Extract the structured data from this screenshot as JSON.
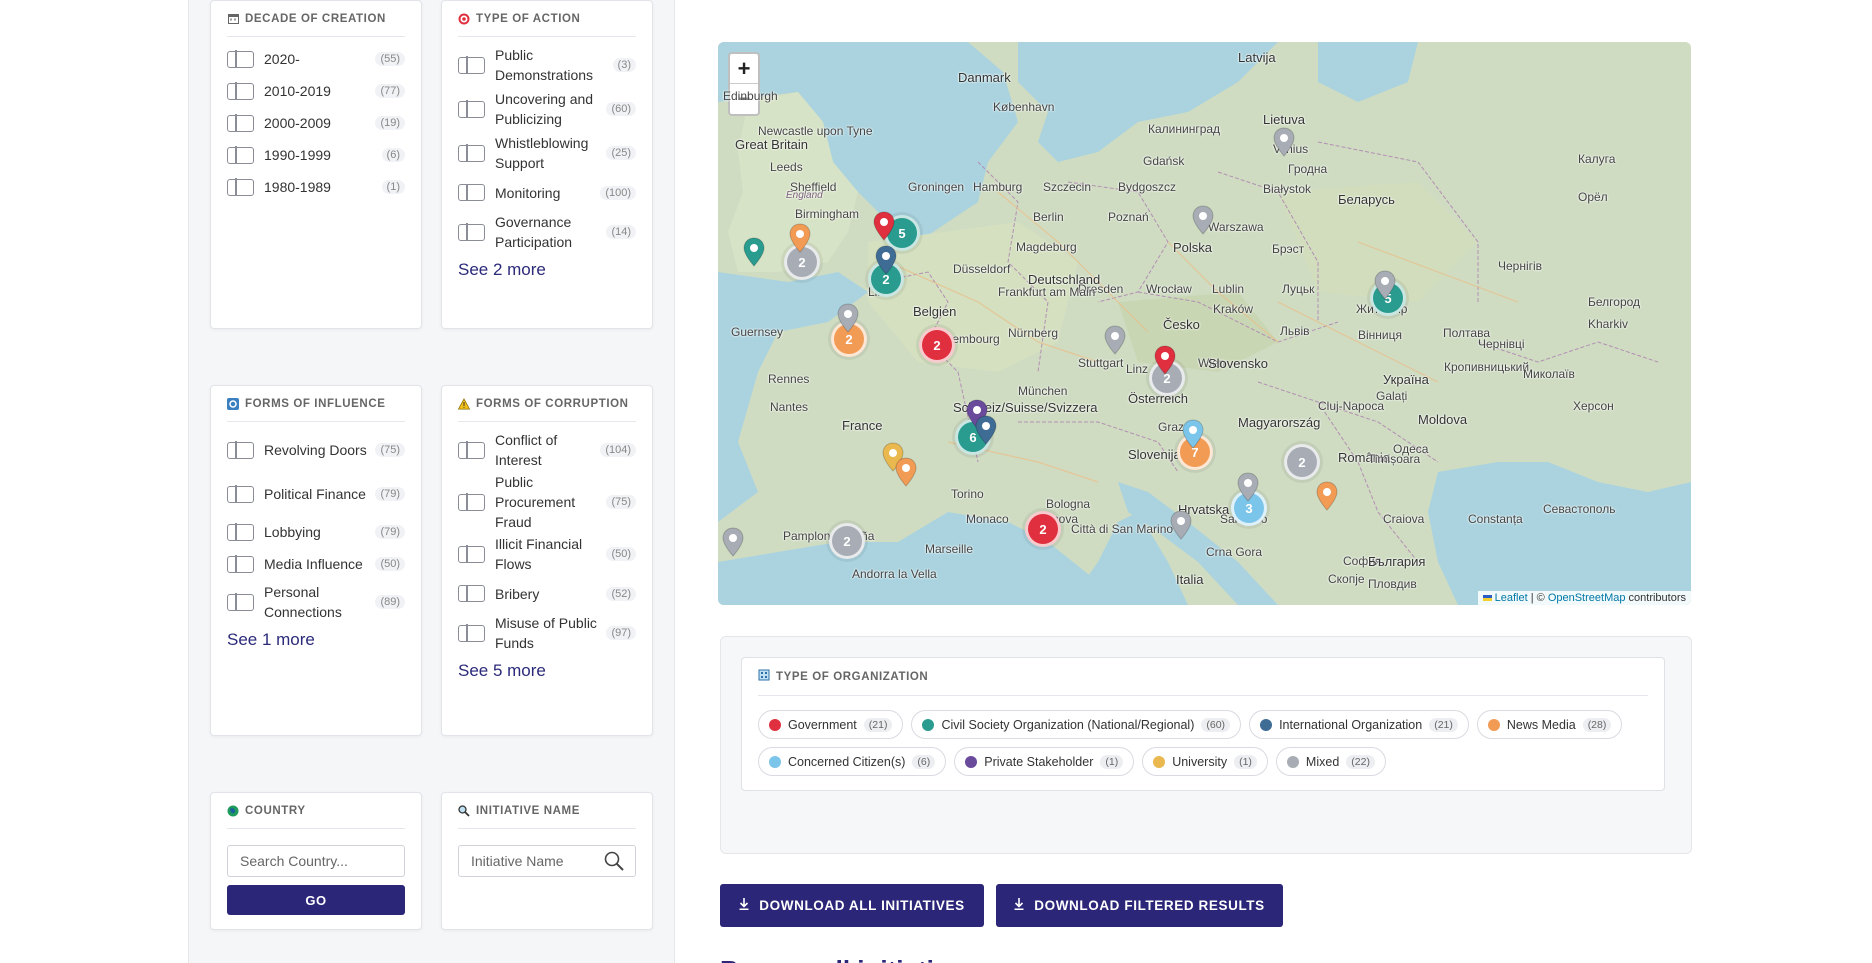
{
  "filters": {
    "decade": {
      "title": "Decade of Creation",
      "icon": "calendar-icon",
      "options": [
        {
          "label": "2020-",
          "count": "(55)"
        },
        {
          "label": "2010-2019",
          "count": "(77)"
        },
        {
          "label": "2000-2009",
          "count": "(19)"
        },
        {
          "label": "1990-1999",
          "count": "(6)"
        },
        {
          "label": "1980-1989",
          "count": "(1)"
        }
      ]
    },
    "action": {
      "title": "Type of Action",
      "icon": "target-icon",
      "options": [
        {
          "label": "Public Demonstrations",
          "count": "(3)"
        },
        {
          "label": "Uncovering and Publicizing",
          "count": "(60)"
        },
        {
          "label": "Whistleblowing Support",
          "count": "(25)"
        },
        {
          "label": "Monitoring",
          "count": "(100)"
        },
        {
          "label": "Governance Participation",
          "count": "(14)"
        }
      ],
      "see_more": "See 2 more"
    },
    "influence": {
      "title": "Forms of Influence",
      "icon": "cycle-icon",
      "options": [
        {
          "label": "Revolving Doors",
          "count": "(75)"
        },
        {
          "label": "Political Finance",
          "count": "(79)"
        },
        {
          "label": "Lobbying",
          "count": "(79)"
        },
        {
          "label": "Media Influence",
          "count": "(50)"
        },
        {
          "label": "Personal Connections",
          "count": "(89)"
        }
      ],
      "see_more": "See 1 more"
    },
    "corruption": {
      "title": "Forms of Corruption",
      "icon": "warning-icon",
      "options": [
        {
          "label": "Conflict of Interest",
          "count": "(104)"
        },
        {
          "label": "Public Procurement Fraud",
          "count": "(75)"
        },
        {
          "label": "Illicit Financial Flows",
          "count": "(50)"
        },
        {
          "label": "Bribery",
          "count": "(52)"
        },
        {
          "label": "Misuse of Public Funds",
          "count": "(97)"
        }
      ],
      "see_more": "See 5 more"
    },
    "country": {
      "title": "Country",
      "placeholder": "Search Country...",
      "button": "GO"
    },
    "initiative": {
      "title": "Initiative Name",
      "placeholder": "Initiative Name"
    }
  },
  "map": {
    "zoom_in": "+",
    "zoom_out": "−",
    "attribution_link": "Leaflet",
    "attribution_sep": " | © ",
    "attribution_osm": "OpenStreetMap",
    "attribution_tail": " contributors",
    "places": [
      {
        "t": "Latvija",
        "c": "country"
      },
      {
        "t": "Danmark",
        "c": "country"
      },
      {
        "t": "København",
        "c": ""
      },
      {
        "t": "Калининград",
        "c": ""
      },
      {
        "t": "Lietuva",
        "c": "country"
      },
      {
        "t": "Vilnius",
        "c": ""
      },
      {
        "t": "Great Britain",
        "c": "country"
      },
      {
        "t": "Leeds",
        "c": ""
      },
      {
        "t": "Sheffield",
        "c": ""
      },
      {
        "t": "Birmingham",
        "c": ""
      },
      {
        "t": "England",
        "c": "region"
      },
      {
        "t": "Groningen",
        "c": ""
      },
      {
        "t": "Hamburg",
        "c": ""
      },
      {
        "t": "Szczecin",
        "c": ""
      },
      {
        "t": "Bydgoszcz",
        "c": ""
      },
      {
        "t": "Gdańsk",
        "c": ""
      },
      {
        "t": "Białystok",
        "c": ""
      },
      {
        "t": "Гродна",
        "c": ""
      },
      {
        "t": "Беларусь",
        "c": "country"
      },
      {
        "t": "Berlin",
        "c": ""
      },
      {
        "t": "Poznań",
        "c": ""
      },
      {
        "t": "Warszawa",
        "c": ""
      },
      {
        "t": "Polska",
        "c": "country"
      },
      {
        "t": "Брэст",
        "c": ""
      },
      {
        "t": "Magdeburg",
        "c": ""
      },
      {
        "t": "Düsseldorf",
        "c": ""
      },
      {
        "t": "Deutschland",
        "c": "country"
      },
      {
        "t": "Dresden",
        "c": ""
      },
      {
        "t": "Wrocław",
        "c": ""
      },
      {
        "t": "Lublin",
        "c": ""
      },
      {
        "t": "Луцьк",
        "c": ""
      },
      {
        "t": "Житомир",
        "c": ""
      },
      {
        "t": "Lille",
        "c": ""
      },
      {
        "t": "Belgien",
        "c": "country"
      },
      {
        "t": "Frankfurt am Main",
        "c": ""
      },
      {
        "t": "Česko",
        "c": "country"
      },
      {
        "t": "Kraków",
        "c": ""
      },
      {
        "t": "Львів",
        "c": ""
      },
      {
        "t": "Вінниця",
        "c": ""
      },
      {
        "t": "Полтава",
        "c": ""
      },
      {
        "t": "Guernsey",
        "c": ""
      },
      {
        "t": "Luxembourg",
        "c": ""
      },
      {
        "t": "Nürnberg",
        "c": ""
      },
      {
        "t": "Stuttgart",
        "c": ""
      },
      {
        "t": "Linz",
        "c": ""
      },
      {
        "t": "Wien",
        "c": ""
      },
      {
        "t": "Slovensko",
        "c": "country"
      },
      {
        "t": "Кропивницький",
        "c": ""
      },
      {
        "t": "Україна",
        "c": "country"
      },
      {
        "t": "Rennes",
        "c": ""
      },
      {
        "t": "München",
        "c": ""
      },
      {
        "t": "Österreich",
        "c": "country"
      },
      {
        "t": "Nantes",
        "c": ""
      },
      {
        "t": "France",
        "c": "country"
      },
      {
        "t": "Schweiz/Suisse/Svizzera",
        "c": "country"
      },
      {
        "t": "Graz",
        "c": ""
      },
      {
        "t": "Magyarország",
        "c": "country"
      },
      {
        "t": "Cluj-Napoca",
        "c": ""
      },
      {
        "t": "Moldova",
        "c": "country"
      },
      {
        "t": "Одеса",
        "c": ""
      },
      {
        "t": "Slovenija",
        "c": "country"
      },
      {
        "t": "România",
        "c": "country"
      },
      {
        "t": "Torino",
        "c": ""
      },
      {
        "t": "Bologna",
        "c": ""
      },
      {
        "t": "Hrvatska",
        "c": "country"
      },
      {
        "t": "Craiova",
        "c": ""
      },
      {
        "t": "Constanța",
        "c": ""
      },
      {
        "t": "Севастополь",
        "c": ""
      },
      {
        "t": "Monaco",
        "c": ""
      },
      {
        "t": "Genova",
        "c": ""
      },
      {
        "t": "Città di San Marino",
        "c": ""
      },
      {
        "t": "Sarajevo",
        "c": ""
      },
      {
        "t": "Pamplona / Iruña",
        "c": ""
      },
      {
        "t": "Marseille",
        "c": ""
      },
      {
        "t": "Crna Gora",
        "c": ""
      },
      {
        "t": "София",
        "c": ""
      },
      {
        "t": "България",
        "c": "country"
      },
      {
        "t": "Andorra la Vella",
        "c": ""
      },
      {
        "t": "Italia",
        "c": "country"
      },
      {
        "t": "Скопје",
        "c": ""
      },
      {
        "t": "Пловдив",
        "c": ""
      },
      {
        "t": "Kharkiv",
        "c": ""
      },
      {
        "t": "Белгород",
        "c": ""
      },
      {
        "t": "Миколаїв",
        "c": ""
      },
      {
        "t": "Херсон",
        "c": ""
      },
      {
        "t": "Орёл",
        "c": ""
      },
      {
        "t": "Калуга",
        "c": ""
      },
      {
        "t": "Чернігів",
        "c": ""
      },
      {
        "t": "Чернівці",
        "c": ""
      },
      {
        "t": "Galați",
        "c": ""
      },
      {
        "t": "Timișoara",
        "c": ""
      },
      {
        "t": "Newcastle upon Tyne",
        "c": ""
      },
      {
        "t": "Edinburgh",
        "c": ""
      }
    ],
    "clusters": [
      {
        "n": "5",
        "cat": "civil"
      },
      {
        "n": "2",
        "cat": "civil"
      },
      {
        "n": "2",
        "cat": "mixed"
      },
      {
        "n": "2",
        "cat": "news"
      },
      {
        "n": "2",
        "cat": "gov"
      },
      {
        "n": "6",
        "cat": "civil"
      },
      {
        "n": "2",
        "cat": "mixed"
      },
      {
        "n": "7",
        "cat": "news"
      },
      {
        "n": "2",
        "cat": "mixed"
      },
      {
        "n": "3",
        "cat": "citizen"
      },
      {
        "n": "5",
        "cat": "civil"
      },
      {
        "n": "2",
        "cat": "gov"
      },
      {
        "n": "2",
        "cat": "mixed"
      }
    ],
    "pins": [
      "gov",
      "civil",
      "news",
      "intl",
      "mixed",
      "mixed",
      "mixed",
      "mixed",
      "private",
      "intl",
      "university",
      "news",
      "gov",
      "citizen",
      "mixed",
      "news",
      "mixed",
      "mixed",
      "mixed"
    ]
  },
  "org_types": {
    "title": "Type of Organization",
    "items": [
      {
        "label": "Government",
        "count": "(21)",
        "color": "#e0303f"
      },
      {
        "label": "Civil Society Organization (National/Regional)",
        "count": "(60)",
        "color": "#2a9b8f"
      },
      {
        "label": "International Organization",
        "count": "(21)",
        "color": "#3f6c95"
      },
      {
        "label": "News Media",
        "count": "(28)",
        "color": "#f29b55"
      },
      {
        "label": "Concerned Citizen(s)",
        "count": "(6)",
        "color": "#7cc5ea"
      },
      {
        "label": "Private Stakeholder",
        "count": "(1)",
        "color": "#6a4a9b"
      },
      {
        "label": "University",
        "count": "(1)",
        "color": "#e9b84e"
      },
      {
        "label": "Mixed",
        "count": "(22)",
        "color": "#a8adb5"
      }
    ]
  },
  "downloads": {
    "all": "DOWNLOAD ALL INITIATIVES",
    "filtered": "DOWNLOAD FILTERED RESULTS"
  },
  "browse_title": "Browse all initiatives",
  "colors": {
    "gov": "#e0303f",
    "civil": "#2a9b8f",
    "intl": "#3f6c95",
    "news": "#f29b55",
    "citizen": "#7cc5ea",
    "private": "#6a4a9b",
    "university": "#e9b84e",
    "mixed": "#a8adb5",
    "brand": "#2c2679"
  }
}
